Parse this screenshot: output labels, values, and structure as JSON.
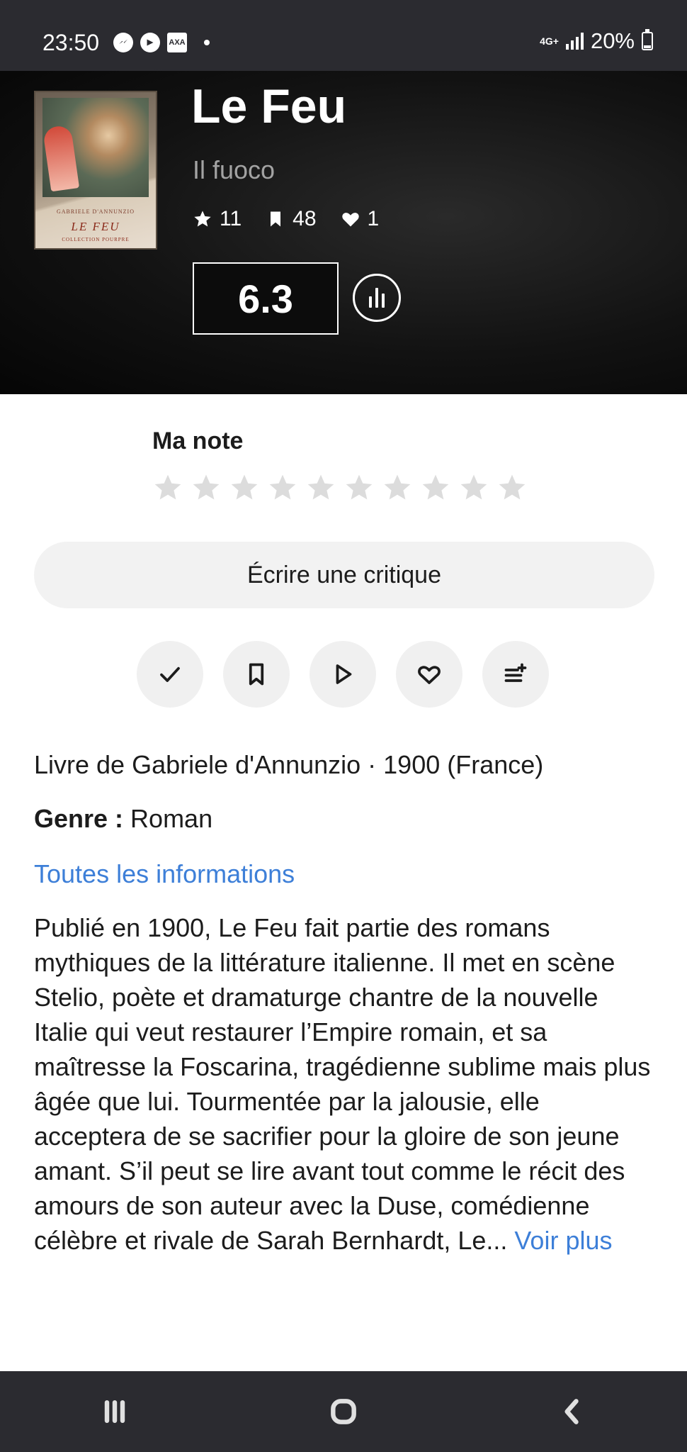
{
  "status_bar": {
    "time": "23:50",
    "network": "4G+",
    "battery": "20%",
    "left_icons": [
      "messenger-icon",
      "sync-icon",
      "axa-icon"
    ],
    "axa_label": "AXA"
  },
  "book": {
    "title": "Le Feu",
    "original_title": "Il fuoco",
    "cover": {
      "author": "GABRIELE D'ANNUNZIO",
      "title": "LE FEU",
      "collection": "COLLECTION POURPRE"
    },
    "stats": {
      "stars": "11",
      "wishlist": "48",
      "favorites": "1"
    },
    "score": "6.3"
  },
  "rating": {
    "label": "Ma note",
    "max": 10,
    "value": 0
  },
  "review_button": "Écrire une critique",
  "actions": [
    {
      "name": "seen",
      "icon": "check-icon"
    },
    {
      "name": "wishlist",
      "icon": "bookmark-icon"
    },
    {
      "name": "in-progress",
      "icon": "play-icon"
    },
    {
      "name": "favorite",
      "icon": "heart-icon"
    },
    {
      "name": "add-to-list",
      "icon": "list-add-icon"
    }
  ],
  "info": {
    "meta": "Livre de Gabriele d'Annunzio · 1900 (France)",
    "genre_label": "Genre :",
    "genre_value": " Roman",
    "all_info_link": "Toutes les informations",
    "synopsis": "Publié en 1900, Le Feu fait partie des romans mythiques de la littérature italienne. Il met en scène Stelio, poète et dramaturge chantre de la nouvelle Italie qui veut restaurer l’Empire romain, et sa maîtresse la Foscarina, tragédienne sublime mais plus âgée que lui. Tourmentée par la jalousie, elle acceptera de se sacrifier pour la gloire de son jeune amant. S’il peut se lire avant tout comme le récit des amours de son auteur avec la Duse, comédienne célèbre et rivale de Sarah Bernhardt, Le... ",
    "see_more": "Voir plus"
  },
  "nav": [
    "recents-icon",
    "home-icon",
    "back-icon"
  ]
}
